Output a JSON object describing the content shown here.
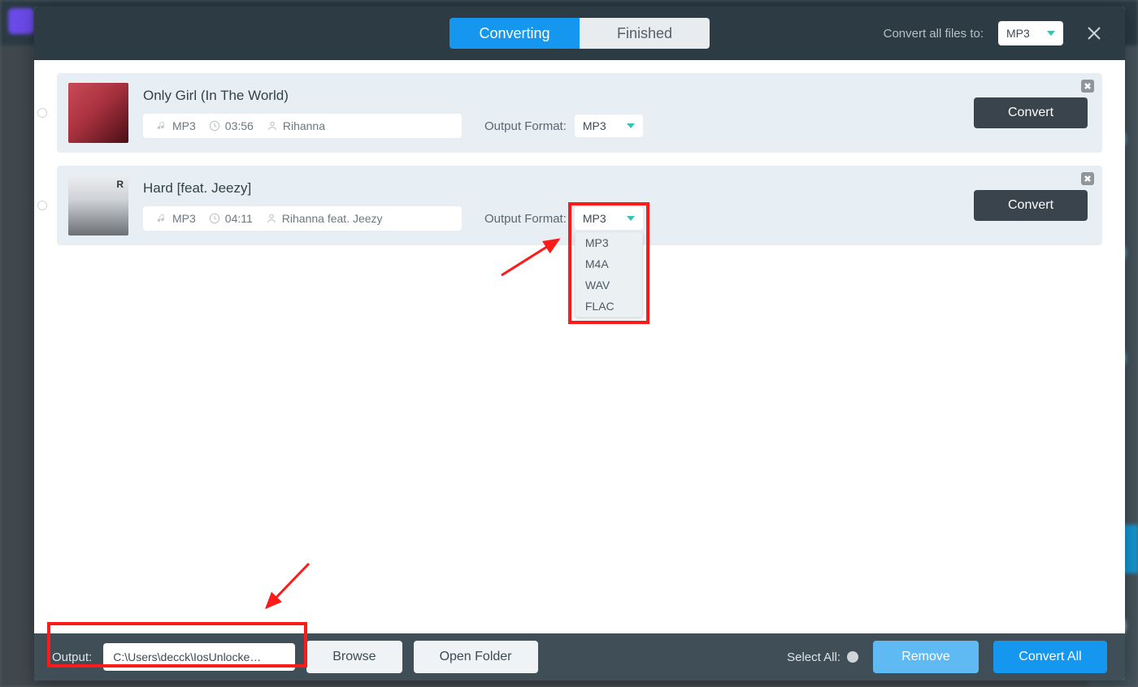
{
  "header": {
    "tabs": {
      "converting": "Converting",
      "finished": "Finished"
    },
    "convert_all_label": "Convert all files to:",
    "convert_all_value": "MP3"
  },
  "tracks": [
    {
      "title": "Only Girl (In The World)",
      "format": "MP3",
      "duration": "03:56",
      "artist": "Rihanna",
      "output_format_label": "Output Format:",
      "output_format_value": "MP3",
      "convert_label": "Convert"
    },
    {
      "title": "Hard [feat. Jeezy]",
      "format": "MP3",
      "duration": "04:11",
      "artist": "Rihanna feat. Jeezy",
      "output_format_label": "Output Format:",
      "output_format_value": "MP3",
      "convert_label": "Convert"
    }
  ],
  "dropdown_options": [
    "MP3",
    "M4A",
    "WAV",
    "FLAC"
  ],
  "footer": {
    "output_label": "Output:",
    "output_path": "C:\\Users\\decck\\IosUnlocke…",
    "browse": "Browse",
    "open_folder": "Open Folder",
    "select_all": "Select All:",
    "remove": "Remove",
    "convert_all": "Convert All"
  }
}
